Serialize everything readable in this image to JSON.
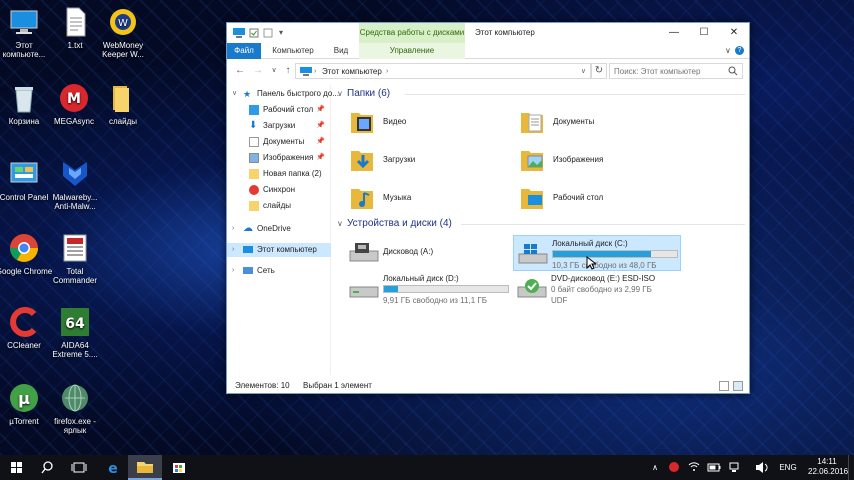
{
  "desktop": {
    "icons": [
      {
        "label": "Этот компьюте..."
      },
      {
        "label": "1.txt"
      },
      {
        "label": "WebMoney Keeper W..."
      },
      {
        "label": "Корзина"
      },
      {
        "label": "MEGAsync"
      },
      {
        "label": "слайды"
      },
      {
        "label": "Control Panel"
      },
      {
        "label": "Malwareby... Anti-Malw..."
      },
      {
        "label": "Google Chrome"
      },
      {
        "label": "Total Commander"
      },
      {
        "label": "CCleaner"
      },
      {
        "label": "AIDA64 Extreme 5...."
      },
      {
        "label": "µTorrent"
      },
      {
        "label": "firefox.exe - ярлык"
      }
    ]
  },
  "window": {
    "title": "Этот компьютер",
    "context_tab": "Средства работы с дисками",
    "tabs": {
      "file": "Файл",
      "computer": "Компьютер",
      "view": "Вид",
      "manage": "Управление"
    },
    "address": "Этот компьютер",
    "search_placeholder": "Поиск: Этот компьютер",
    "minimize": "—",
    "maximize": "☐",
    "close": "✕"
  },
  "nav_pane": {
    "quick_access": "Панель быстрого до...",
    "items": [
      {
        "label": "Рабочий стол",
        "pinned": true
      },
      {
        "label": "Загрузки",
        "pinned": true
      },
      {
        "label": "Документы",
        "pinned": true
      },
      {
        "label": "Изображения",
        "pinned": true
      },
      {
        "label": "Новая папка (2)",
        "pinned": false
      },
      {
        "label": "Синхрон",
        "pinned": false
      },
      {
        "label": "слайды",
        "pinned": false
      }
    ],
    "onedrive": "OneDrive",
    "this_pc": "Этот компьютер",
    "network": "Сеть"
  },
  "content": {
    "folders_header": "Папки (6)",
    "folders": [
      {
        "label": "Видео"
      },
      {
        "label": "Документы"
      },
      {
        "label": "Загрузки"
      },
      {
        "label": "Изображения"
      },
      {
        "label": "Музыка"
      },
      {
        "label": "Рабочий стол"
      }
    ],
    "devices_header": "Устройства и диски (4)",
    "drives": [
      {
        "name": "Дисковод (A:)",
        "used_fraction": null,
        "free": ""
      },
      {
        "name": "Локальный диск (C:)",
        "used_fraction": 0.79,
        "free": "10,3 ГБ свободно из 48,0 ГБ"
      },
      {
        "name": "Локальный диск (D:)",
        "used_fraction": 0.11,
        "free": "9,91 ГБ свободно из 11,1 ГБ"
      },
      {
        "name": "DVD-дисковод (E:) ESD-ISO",
        "used_fraction": null,
        "free": "0 байт свободно из 2,99 ГБ",
        "fs": "UDF"
      }
    ]
  },
  "status": {
    "count": "Элементов: 10",
    "selected": "Выбран 1 элемент"
  },
  "taskbar": {
    "language": "ENG",
    "time": "14:11",
    "date": "22.06.2016"
  },
  "colors": {
    "accent": "#1979ca",
    "selection": "#cce8ff",
    "drive_bar": "#26a0da",
    "context_tab": "#d8f0c8"
  }
}
